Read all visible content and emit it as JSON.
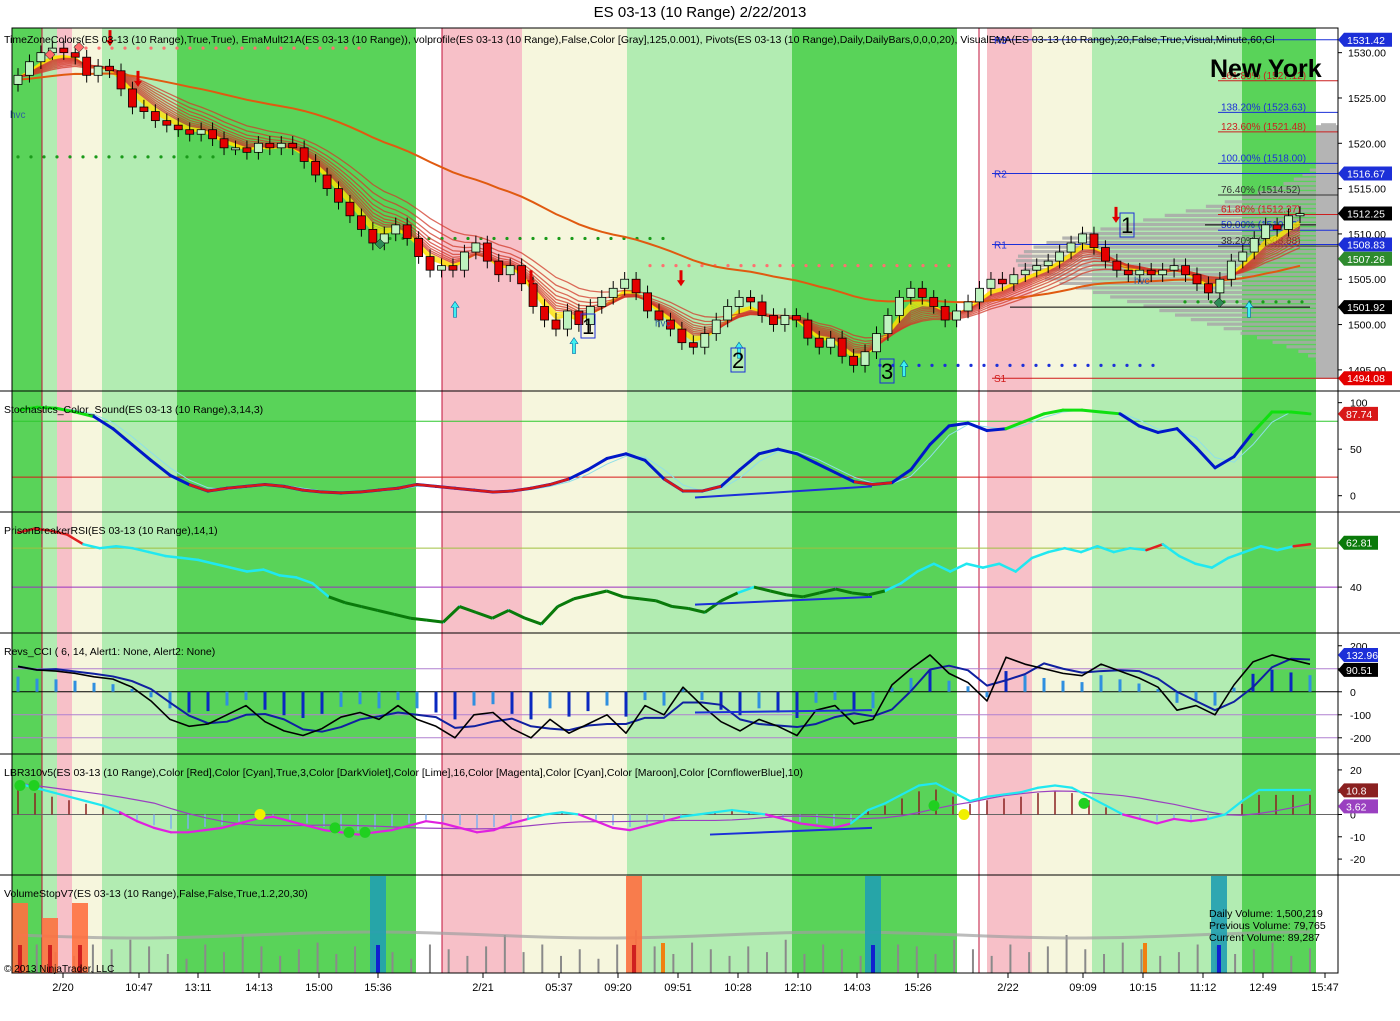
{
  "window": {
    "title": "ES 03-13 (10 Range)  2/22/2013",
    "copyright": "© 2013 NinjaTrader, LLC",
    "watermark": "New York"
  },
  "colors": {
    "zone_green": "#59d359",
    "zone_lightgreen": "#b2ecb2",
    "zone_cream": "#f6f6dd",
    "zone_pink": "#f7c0c8",
    "up_candle": "#bff3bf",
    "down_candle": "#e40000",
    "ema_yellow": "#ffff00",
    "ema_red": "#cc1f1f",
    "blue_arrow": "#1c2fd8",
    "stoch_blue": "#0018c8",
    "stoch_green": "#10e010",
    "rsi_cyan": "#20e8f0",
    "rsi_green": "#0a7a0a",
    "cci_bar": "#2f8fe0",
    "lbr_magenta": "#e020e0",
    "lbr_cyan": "#20e8f0"
  },
  "chart_data": [
    {
      "panel": "price",
      "type": "candlestick",
      "label": "TimeZoneColors(ES 03-13 (10 Range),True,True), EmaMult21A(ES 03-13 (10 Range)), volprofile(ES 03-13 (10 Range),False,Color [Gray],125,0.001), Pivots(ES 03-13 (10 Range),Daily,DailyBars,0,0,0,20), VisualEMA(ES 03-13 (10 Range),20,False,True,Visual,Minute,60,Cl",
      "y_ticks": [
        1530,
        1525,
        1520,
        1515,
        1510,
        1505,
        1500,
        1495
      ],
      "y_tick_labels": [
        "1530.00",
        "1525.00",
        "1520.00",
        "1515.00",
        "1510.00",
        "1505.00",
        "1500.00",
        "1495.00"
      ],
      "ylim": [
        1493,
        1532.5
      ],
      "close": [
        1527.5,
        1529,
        1530,
        1530.5,
        1530,
        1529.5,
        1527.5,
        1528.5,
        1528,
        1526,
        1524,
        1523.5,
        1522.5,
        1522,
        1521.5,
        1521,
        1521.5,
        1520.5,
        1519.5,
        1519.5,
        1519,
        1520,
        1519.5,
        1520,
        1519.5,
        1518,
        1516.5,
        1515,
        1513.5,
        1512,
        1510.5,
        1509,
        1510,
        1511,
        1509.5,
        1507.5,
        1506,
        1506.5,
        1506,
        1508,
        1509,
        1507,
        1505.5,
        1506.5,
        1504.5,
        1502,
        1500.5,
        1499.5,
        1501.5,
        1500,
        1502,
        1503,
        1504,
        1505,
        1503.5,
        1501.5,
        1500.5,
        1499.5,
        1498,
        1497.5,
        1499,
        1500.5,
        1502,
        1503,
        1502.5,
        1501,
        1500,
        1501,
        1500.5,
        1498.5,
        1497.5,
        1498.5,
        1496.5,
        1495.5,
        1497,
        1499,
        1501,
        1503,
        1504,
        1503,
        1502,
        1500.5,
        1501.5,
        1502.5,
        1504,
        1505,
        1504.5,
        1505.5,
        1506,
        1506.5,
        1507,
        1508,
        1509,
        1510,
        1508.5,
        1507,
        1506,
        1505.5,
        1506,
        1505.5,
        1506,
        1506.5,
        1505.5,
        1504.5,
        1503.5,
        1505,
        1507,
        1508,
        1509.5,
        1511,
        1510.5,
        1512,
        1512.25
      ]
    },
    {
      "panel": "stochastics",
      "type": "line",
      "label": "Stochastics_Color_Sound(ES 03-13 (10 Range),3,14,3)",
      "y_ticks": [
        100,
        50,
        0
      ],
      "ylim": [
        -10,
        105
      ],
      "current_value": "87.74",
      "values": [
        92,
        95,
        94,
        90,
        85,
        72,
        55,
        38,
        22,
        12,
        5,
        8,
        10,
        12,
        10,
        6,
        4,
        3,
        4,
        6,
        8,
        12,
        10,
        8,
        6,
        4,
        5,
        8,
        12,
        18,
        28,
        40,
        45,
        38,
        18,
        5,
        5,
        10,
        28,
        45,
        50,
        45,
        35,
        25,
        15,
        12,
        14,
        28,
        55,
        75,
        78,
        70,
        72,
        80,
        88,
        92,
        92,
        90,
        88,
        75,
        68,
        72,
        52,
        30,
        42,
        68,
        90,
        90,
        88
      ]
    },
    {
      "panel": "rsi",
      "type": "line",
      "label": "PrisonBreakerRSI(ES 03-13 (10 Range),14,1)",
      "y_ticks": [
        40
      ],
      "ylim": [
        20,
        75
      ],
      "current_value": "62.81",
      "values": [
        68,
        70,
        69,
        67,
        62,
        60,
        61,
        60,
        58,
        56,
        55,
        54,
        52,
        50,
        48,
        49,
        46,
        45,
        42,
        35,
        32,
        30,
        28,
        26,
        24,
        23,
        22,
        30,
        27,
        24,
        28,
        24,
        21,
        30,
        34,
        36,
        38,
        35,
        34,
        33,
        30,
        29,
        27,
        33,
        37,
        40,
        38,
        36,
        35,
        37,
        39,
        37,
        36,
        38,
        42,
        48,
        52,
        48,
        52,
        50,
        52,
        48,
        55,
        58,
        60,
        58,
        61,
        58,
        60,
        59,
        62,
        56,
        52,
        50,
        55,
        58,
        61,
        59,
        61,
        62
      ]
    },
    {
      "panel": "cci",
      "type": "line",
      "label": "Revs_CCI ( 6, 14, Alert1: None, Alert2: None)",
      "y_ticks": [
        200,
        100,
        0,
        -100,
        -200
      ],
      "ylim": [
        -240,
        225
      ],
      "current_value": "132.96",
      "current_value_2": "90.51",
      "values": [
        110,
        95,
        90,
        80,
        65,
        55,
        20,
        -40,
        -120,
        -150,
        -140,
        -100,
        -60,
        -130,
        -170,
        -190,
        -160,
        -110,
        -90,
        -120,
        -60,
        -120,
        -150,
        -200,
        -100,
        -90,
        -160,
        -200,
        -120,
        -180,
        -140,
        -100,
        -180,
        -60,
        -100,
        20,
        -60,
        -130,
        -170,
        -120,
        -150,
        -190,
        -80,
        -60,
        -140,
        -120,
        30,
        100,
        160,
        80,
        40,
        -40,
        150,
        120,
        100,
        80,
        70,
        120,
        90,
        60,
        20,
        -80,
        -60,
        -100,
        30,
        130,
        160,
        140,
        120
      ]
    },
    {
      "panel": "lbr",
      "type": "line",
      "label": "LBR310v5(ES 03-13 (10 Range),Color [Red],Color [Cyan],True,3,Color [DarkViolet],Color [Lime],16,Color [Magenta],Color [Cyan],Color [Maroon],Color [CornflowerBlue],10)",
      "y_ticks": [
        20,
        10,
        0,
        -10,
        -20
      ],
      "ylim": [
        -24,
        24
      ],
      "current_value": "10.8",
      "current_value_2": "3.62",
      "values": [
        14,
        12,
        10,
        8,
        6,
        4,
        1,
        -3,
        -6,
        -8,
        -8,
        -7,
        -6,
        -4,
        -2,
        -1,
        -3,
        -5,
        -7,
        -8,
        -9,
        -8,
        -7,
        -5,
        -3,
        -4,
        -6,
        -8,
        -7,
        -4,
        -2,
        0,
        1,
        0,
        -3,
        -6,
        -7,
        -5,
        -3,
        -1,
        0,
        1,
        2,
        1,
        0,
        -2,
        -4,
        -5,
        -6,
        -4,
        2,
        5,
        9,
        13,
        14,
        10,
        6,
        8,
        9,
        10,
        12,
        13,
        12,
        8,
        4,
        0,
        -2,
        -4,
        -2,
        -3,
        -2,
        0,
        6,
        11,
        11,
        11,
        11
      ]
    },
    {
      "panel": "volume",
      "type": "bar",
      "label": "VolumeStopV7(ES 03-13 (10 Range),False,False,True,1.2,20,30)",
      "daily_volume": "Daily Volume: 1,500,219",
      "previous_volume": "Previous Volume: 79,765",
      "current_volume": "Current Volume: 89,287",
      "values": [
        40,
        30,
        22,
        18,
        30,
        25,
        35,
        28,
        20,
        15,
        30,
        22,
        40,
        28,
        18,
        25,
        32,
        20,
        28,
        35,
        22,
        15,
        30,
        25,
        18,
        28,
        40,
        22,
        30,
        18,
        25,
        15,
        30,
        45,
        28,
        20,
        32,
        25,
        18,
        28,
        22,
        35,
        20,
        30,
        25,
        18,
        22,
        30,
        28,
        20,
        35,
        25,
        18,
        30,
        22,
        28,
        40,
        25,
        20,
        32,
        25,
        18,
        22,
        30,
        28,
        20,
        25,
        32,
        18,
        26
      ]
    }
  ],
  "price_axis_labels": [
    {
      "text": "1531.42",
      "value": 1531.42,
      "color": "#1c2fd8"
    },
    {
      "text": "1516.67",
      "value": 1516.67,
      "color": "#1c2fd8"
    },
    {
      "text": "1512.25",
      "value": 1512.25,
      "color": "#000000"
    },
    {
      "text": "1508.83",
      "value": 1508.83,
      "color": "#1c2fd8"
    },
    {
      "text": "1507.26",
      "value": 1507.26,
      "color": "#2e8b2e"
    },
    {
      "text": "1501.92",
      "value": 1501.92,
      "color": "#000000"
    },
    {
      "text": "1494.08",
      "value": 1494.08,
      "color": "#e40000"
    }
  ],
  "pivots": [
    {
      "label": "R3",
      "value": 1531.42
    },
    {
      "label": "R2",
      "value": 1516.67
    },
    {
      "label": "R1",
      "value": 1508.83
    },
    {
      "label": "S1",
      "value": 1494.08
    }
  ],
  "fib_levels": [
    {
      "text": "161.80% (1527.12)",
      "value": 1527.12,
      "color": "#cc1f1f"
    },
    {
      "text": "138.20% (1523.63)",
      "value": 1523.63,
      "color": "#1c2fd8"
    },
    {
      "text": "123.60% (1521.48)",
      "value": 1521.48,
      "color": "#cc1f1f"
    },
    {
      "text": "100.00% (1518.00)",
      "value": 1518.0,
      "color": "#1c2fd8"
    },
    {
      "text": "76.40% (1514.52)",
      "value": 1514.52,
      "color": "#333333"
    },
    {
      "text": "61.80% (1512.37)",
      "value": 1512.37,
      "color": "#cc1f1f"
    },
    {
      "text": "50.00% (1510.63)",
      "value": 1510.63,
      "color": "#1c2fd8"
    },
    {
      "text": "38.20% (1508.88)",
      "value": 1508.88,
      "color": "#333333"
    }
  ],
  "wave_labels": [
    "1",
    "2",
    "3",
    "1"
  ],
  "hvc_label": "hvc",
  "x_axis_labels": [
    "2/20",
    "10:47",
    "13:11",
    "14:13",
    "15:00",
    "15:36",
    "2/21",
    "05:37",
    "09:20",
    "09:51",
    "10:28",
    "12:10",
    "14:03",
    "15:26",
    "2/22",
    "09:09",
    "10:15",
    "11:12",
    "12:49",
    "15:47"
  ]
}
